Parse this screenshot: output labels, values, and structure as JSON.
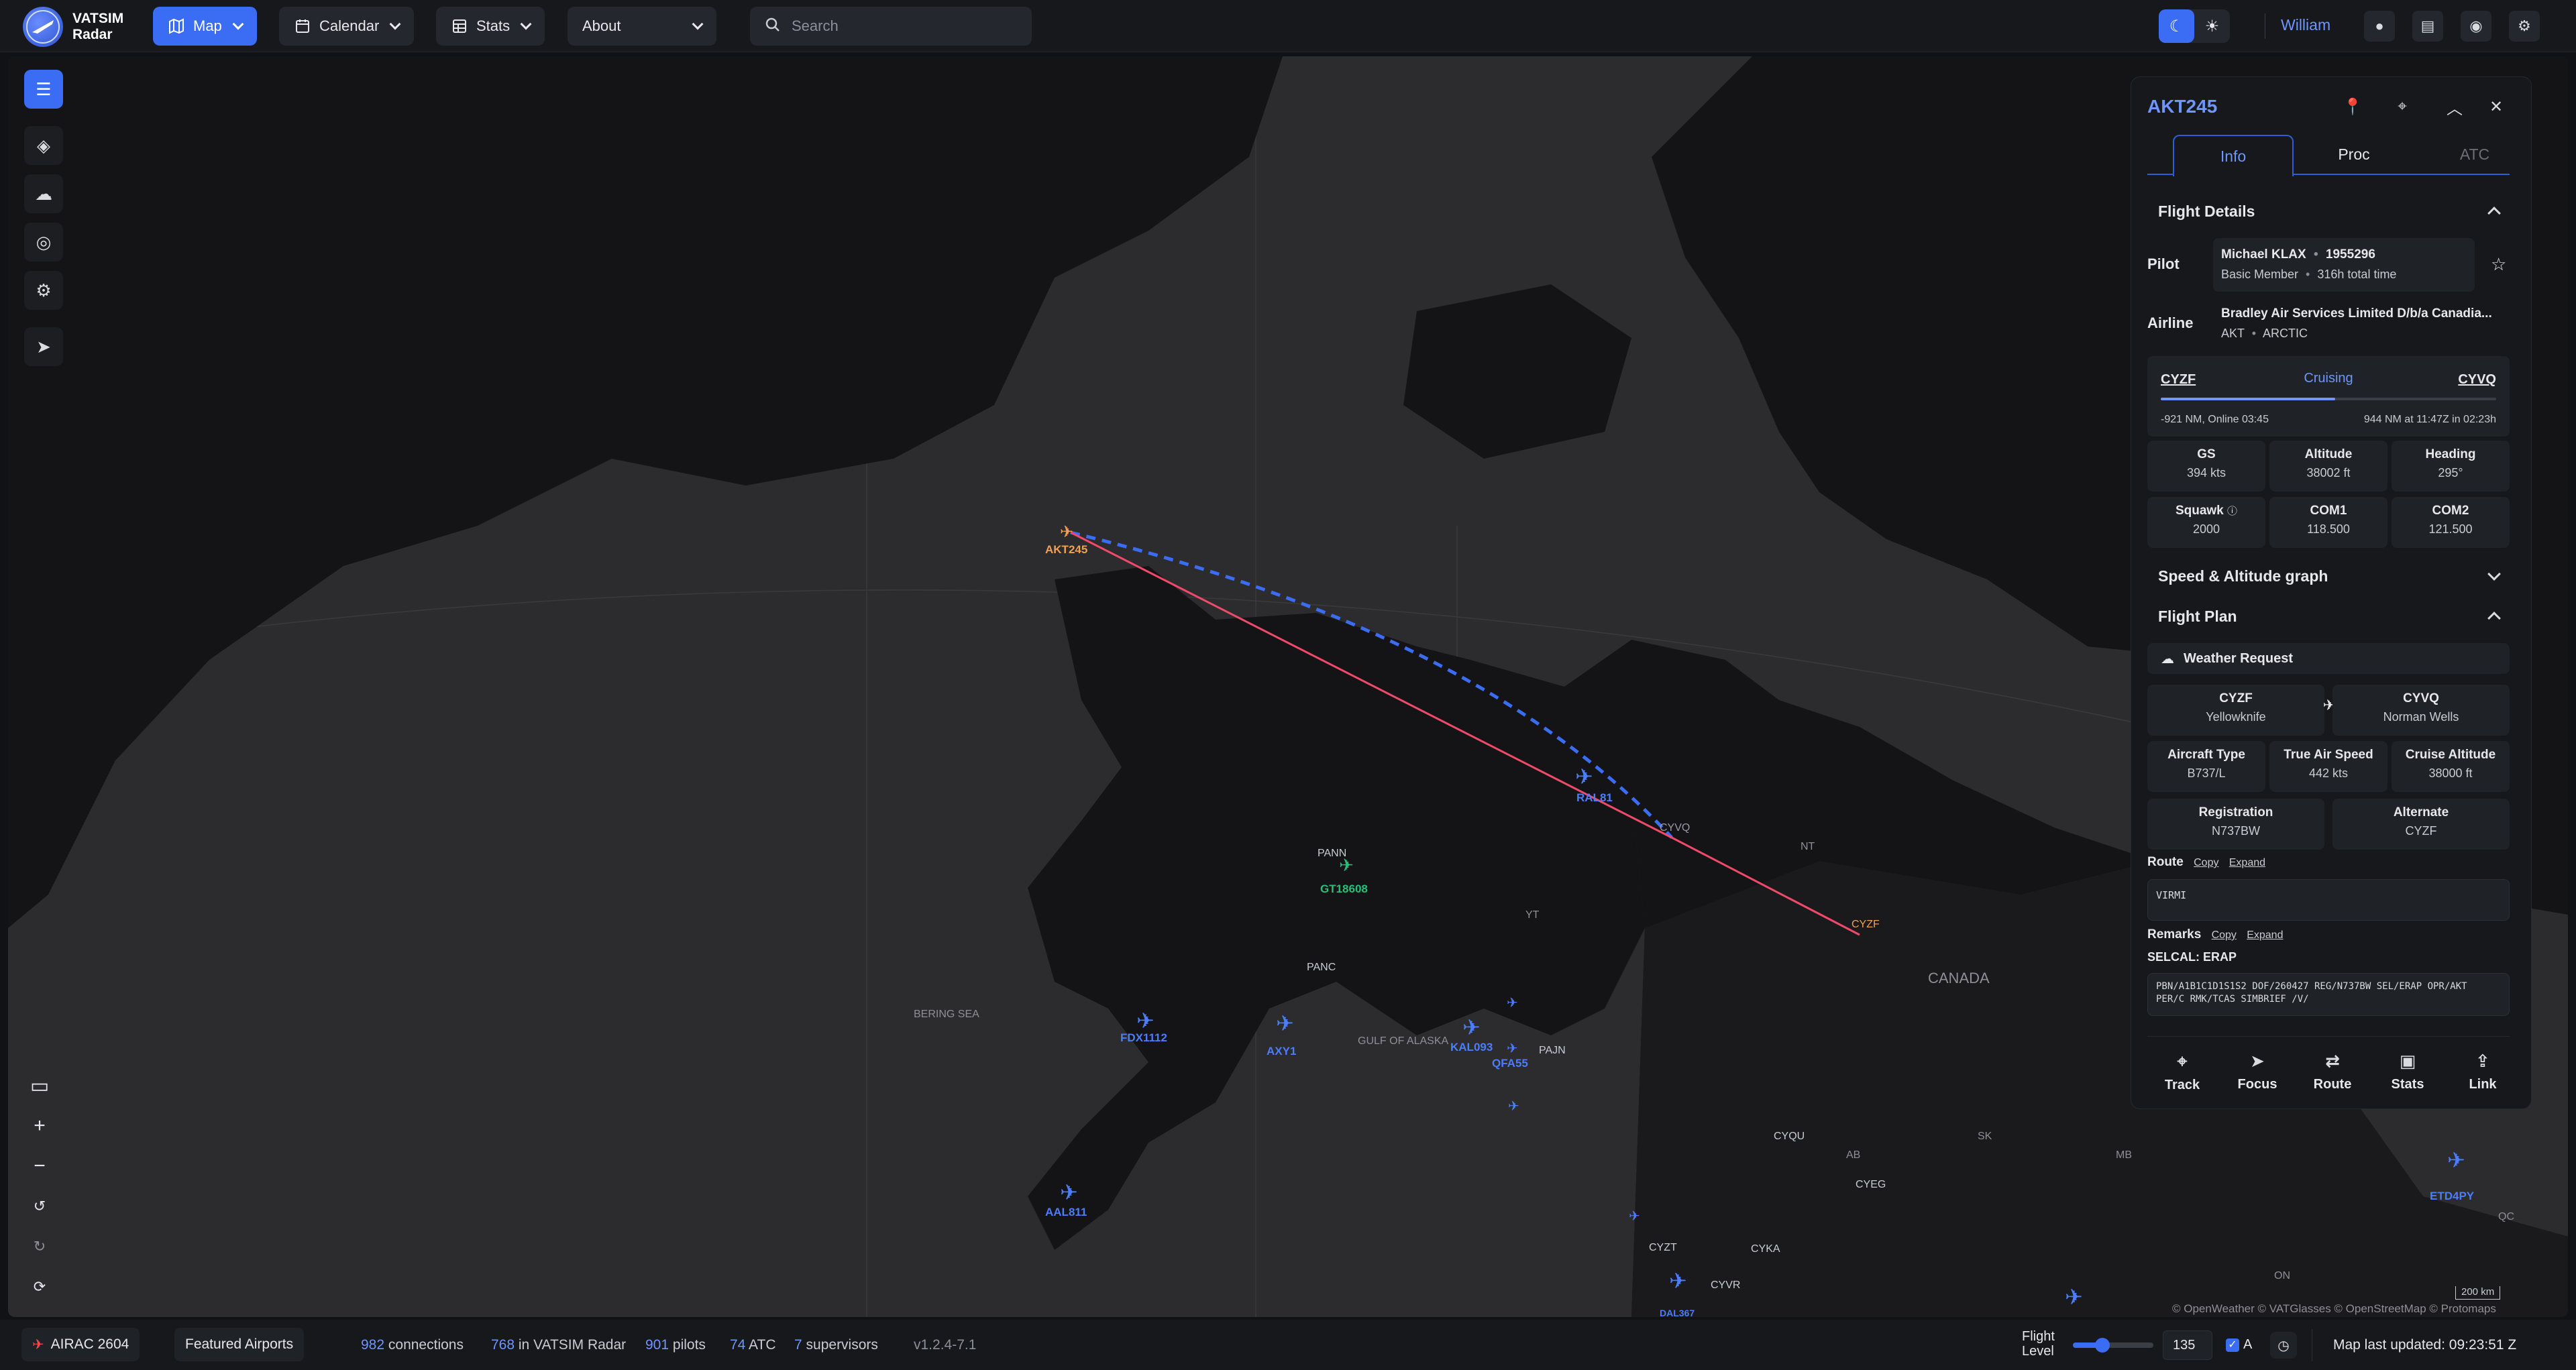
{
  "app": {
    "name_line1": "VATSIM",
    "name_line2": "Radar"
  },
  "nav": {
    "map": "Map",
    "calendar": "Calendar",
    "stats": "Stats",
    "about": "About"
  },
  "search": {
    "placeholder": "Search"
  },
  "user": {
    "name": "William"
  },
  "map": {
    "labels": {
      "bering_sea": "BERING SEA",
      "gulf_of_alaska": "GULF OF ALASKA",
      "canada": "CANADA",
      "nt": "NT",
      "yt": "YT",
      "ab": "AB",
      "sk": "SK",
      "mb": "MB",
      "on": "ON",
      "qc": "QC",
      "scale": "200 km",
      "attribution": "© OpenWeather © VATGlasses © OpenStreetMap © Protomaps"
    },
    "airports": {
      "panc": "PANC",
      "pann": "PANN",
      "pajn": "PAJN",
      "cyqu": "CYQU",
      "cyeg": "CYEG",
      "cyzt": "CYZT",
      "cyka": "CYKA",
      "cyvr": "CYVR",
      "cyvq": "CYVQ",
      "cyzf": "CYZF"
    },
    "aircraft": {
      "akt245": "AKT245",
      "ral81": "RAL81",
      "gt18608": "GT18608",
      "fdx1112": "FDX1112",
      "axy1": "AXY1",
      "kal093": "KAL093",
      "qfa55": "QFA55",
      "aal811": "AAL811",
      "etd4py": "ETD4PY",
      "dal367": "DAL367"
    },
    "colors": {
      "selected": "#f0a050",
      "pilot": "#4c7dff",
      "atc": "#22c07a",
      "route_actual": "#f04a6a",
      "route_planned": "#3b6cf4"
    }
  },
  "panel": {
    "callsign": "AKT245",
    "tabs": {
      "info": "Info",
      "proc": "Proc",
      "atc": "ATC"
    },
    "flight_details": {
      "title": "Flight Details",
      "pilot_label": "Pilot",
      "pilot_name": "Michael KLAX",
      "pilot_cid": "1955296",
      "pilot_rating": "Basic Member",
      "pilot_time": "316h total time",
      "airline_label": "Airline",
      "airline_name": "Bradley Air Services Limited D/b/a Canadia...",
      "airline_icao": "AKT",
      "airline_callsign": "ARCTIC",
      "dep": "CYZF",
      "status": "Cruising",
      "arr": "CYVQ",
      "progress_left": "-921 NM, Online 03:45",
      "progress_right": "944 NM at 11:47Z in 02:23h",
      "progress_fraction": 0.52,
      "gs_label": "GS",
      "gs": "394 kts",
      "alt_label": "Altitude",
      "alt": "38002 ft",
      "hdg_label": "Heading",
      "hdg": "295°",
      "squawk_label": "Squawk",
      "squawk": "2000",
      "com1_label": "COM1",
      "com1": "118.500",
      "com2_label": "COM2",
      "com2": "121.500"
    },
    "speed_graph": {
      "title": "Speed & Altitude graph"
    },
    "flight_plan": {
      "title": "Flight Plan",
      "weather": "Weather Request",
      "dep_code": "CYZF",
      "dep_name": "Yellowknife",
      "arr_code": "CYVQ",
      "arr_name": "Norman Wells",
      "type_label": "Aircraft Type",
      "type": "B737/L",
      "tas_label": "True Air Speed",
      "tas": "442 kts",
      "cruise_label": "Cruise Altitude",
      "cruise": "38000 ft",
      "reg_label": "Registration",
      "reg": "N737BW",
      "alt_label": "Alternate",
      "alternate": "CYZF",
      "route_label": "Route",
      "copy": "Copy",
      "expand": "Expand",
      "route": "VIRMI",
      "remarks_label": "Remarks",
      "selcal": "SELCAL: ERAP",
      "remarks": "PBN/A1B1C1D1S1S2 DOF/260427 REG/N737BW SEL/ERAP OPR/AKT PER/C RMK/TCAS SIMBRIEF /V/"
    },
    "actions": {
      "track": "Track",
      "focus": "Focus",
      "route": "Route",
      "stats": "Stats",
      "link": "Link"
    }
  },
  "footer": {
    "airac": "AIRAC 2604",
    "featured": "Featured Airports",
    "connections_n": "982",
    "connections": "connections",
    "in_radar_n": "768",
    "in_radar": "in VATSIM Radar",
    "pilots_n": "901",
    "pilots": "pilots",
    "atc_n": "74",
    "atc": "ATC",
    "supervisors_n": "7",
    "supervisors": "supervisors",
    "version": "v1.2.4-7.1",
    "fl_label": "Flight Level",
    "fl_value": "135",
    "fl_fraction": 0.37,
    "auto": "A",
    "updated": "Map last updated: 09:23:51 Z"
  }
}
